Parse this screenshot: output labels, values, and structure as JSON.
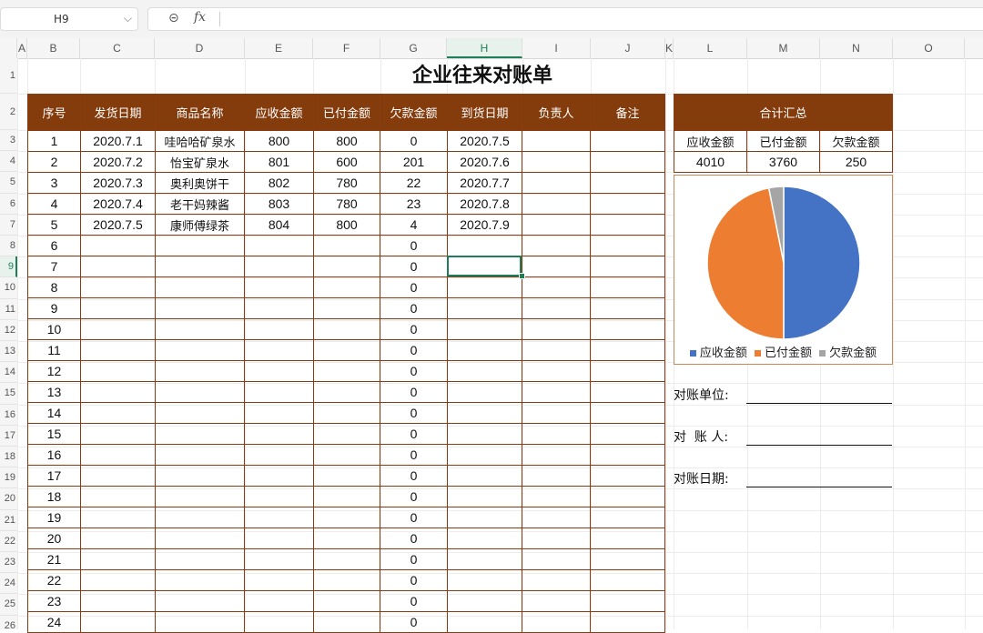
{
  "formula_bar": {
    "cell_ref": "H9",
    "formula": ""
  },
  "columns": [
    "A",
    "B",
    "C",
    "D",
    "E",
    "F",
    "G",
    "H",
    "I",
    "J",
    "K",
    "L",
    "M",
    "N",
    "O"
  ],
  "selected_column": "H",
  "rows": [
    "1",
    "2",
    "3",
    "4",
    "5",
    "6",
    "7",
    "8",
    "9",
    "10",
    "11",
    "12",
    "13",
    "14",
    "15",
    "16",
    "17",
    "18",
    "19",
    "20",
    "21",
    "22",
    "23",
    "24",
    "25",
    "26"
  ],
  "selected_row": "9",
  "sheet": {
    "title": "企业往来对账单",
    "headers": [
      "序号",
      "发货日期",
      "商品名称",
      "应收金额",
      "已付金额",
      "欠款金额",
      "到货日期",
      "负责人",
      "备注"
    ],
    "rows": [
      [
        "1",
        "2020.7.1",
        "哇哈哈矿泉水",
        "800",
        "800",
        "0",
        "2020.7.5",
        "",
        ""
      ],
      [
        "2",
        "2020.7.2",
        "怡宝矿泉水",
        "801",
        "600",
        "201",
        "2020.7.6",
        "",
        ""
      ],
      [
        "3",
        "2020.7.3",
        "奥利奥饼干",
        "802",
        "780",
        "22",
        "2020.7.7",
        "",
        ""
      ],
      [
        "4",
        "2020.7.4",
        "老干妈辣酱",
        "803",
        "780",
        "23",
        "2020.7.8",
        "",
        ""
      ],
      [
        "5",
        "2020.7.5",
        "康师傅绿茶",
        "804",
        "800",
        "4",
        "2020.7.9",
        "",
        ""
      ],
      [
        "6",
        "",
        "",
        "",
        "",
        "0",
        "",
        "",
        ""
      ],
      [
        "7",
        "",
        "",
        "",
        "",
        "0",
        "",
        "",
        ""
      ],
      [
        "8",
        "",
        "",
        "",
        "",
        "0",
        "",
        "",
        ""
      ],
      [
        "9",
        "",
        "",
        "",
        "",
        "0",
        "",
        "",
        ""
      ],
      [
        "10",
        "",
        "",
        "",
        "",
        "0",
        "",
        "",
        ""
      ],
      [
        "11",
        "",
        "",
        "",
        "",
        "0",
        "",
        "",
        ""
      ],
      [
        "12",
        "",
        "",
        "",
        "",
        "0",
        "",
        "",
        ""
      ],
      [
        "13",
        "",
        "",
        "",
        "",
        "0",
        "",
        "",
        ""
      ],
      [
        "14",
        "",
        "",
        "",
        "",
        "0",
        "",
        "",
        ""
      ],
      [
        "15",
        "",
        "",
        "",
        "",
        "0",
        "",
        "",
        ""
      ],
      [
        "16",
        "",
        "",
        "",
        "",
        "0",
        "",
        "",
        ""
      ],
      [
        "17",
        "",
        "",
        "",
        "",
        "0",
        "",
        "",
        ""
      ],
      [
        "18",
        "",
        "",
        "",
        "",
        "0",
        "",
        "",
        ""
      ],
      [
        "19",
        "",
        "",
        "",
        "",
        "0",
        "",
        "",
        ""
      ],
      [
        "20",
        "",
        "",
        "",
        "",
        "0",
        "",
        "",
        ""
      ],
      [
        "21",
        "",
        "",
        "",
        "",
        "0",
        "",
        "",
        ""
      ],
      [
        "22",
        "",
        "",
        "",
        "",
        "0",
        "",
        "",
        ""
      ],
      [
        "23",
        "",
        "",
        "",
        "",
        "0",
        "",
        "",
        ""
      ],
      [
        "24",
        "",
        "",
        "",
        "",
        "0",
        "",
        "",
        ""
      ]
    ]
  },
  "summary": {
    "title": "合计汇总",
    "headers": [
      "应收金额",
      "已付金额",
      "欠款金额"
    ],
    "values": [
      "4010",
      "3760",
      "250"
    ]
  },
  "chart_data": {
    "type": "pie",
    "categories": [
      "应收金额",
      "已付金额",
      "欠款金额"
    ],
    "values": [
      4010,
      3760,
      250
    ],
    "colors": [
      "#4472c4",
      "#ed7d31",
      "#a5a5a5"
    ],
    "legend": "bottom"
  },
  "signature": {
    "unit_label": "对账单位:",
    "person_label": "对  账 人:",
    "date_label": "对账日期:"
  },
  "colors": {
    "header_bg": "#843c0c",
    "selection": "#1e7e57"
  }
}
